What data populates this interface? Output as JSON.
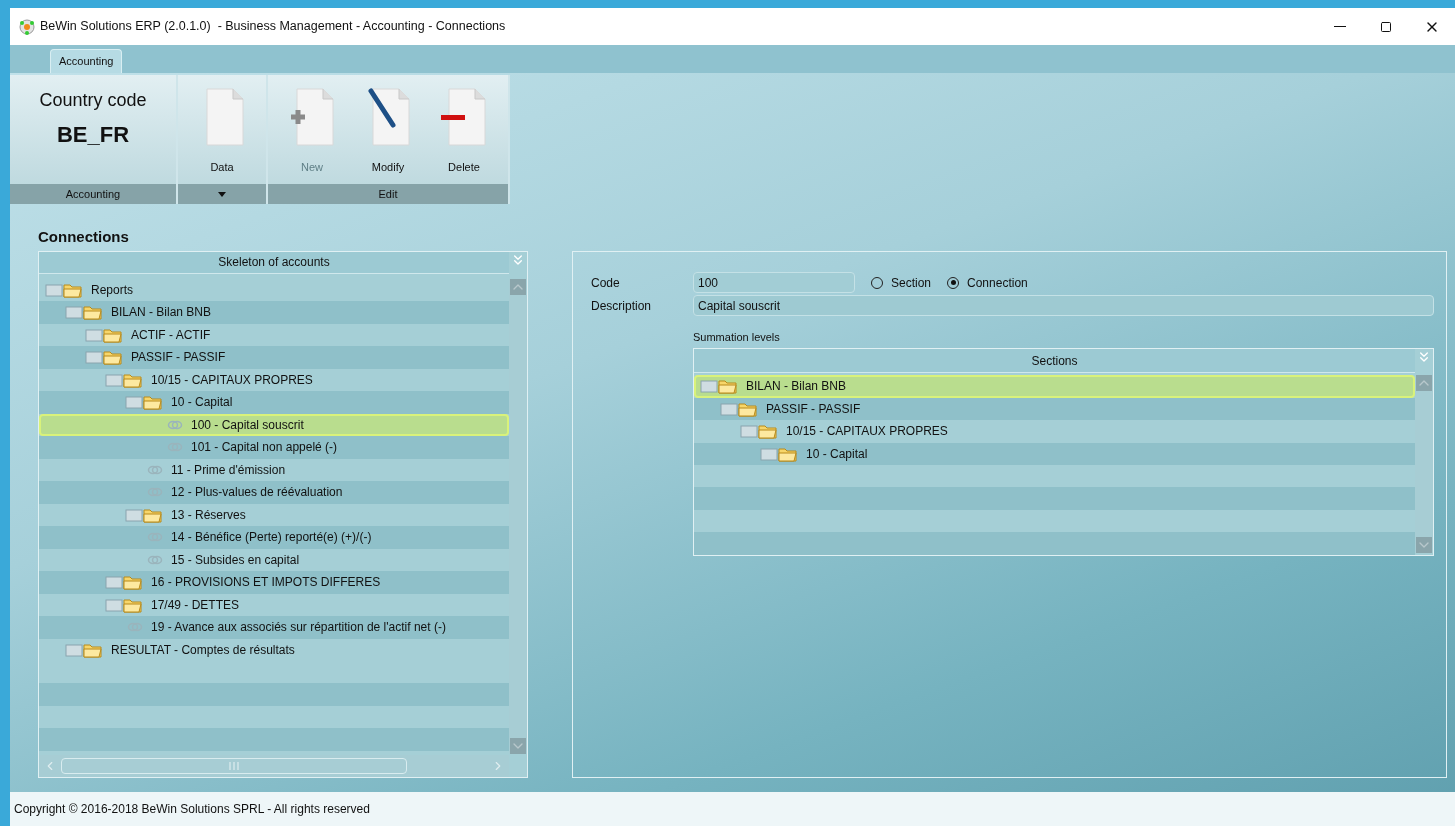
{
  "window": {
    "title": "BeWin Solutions ERP (2.0.1.0)  - Business Management - Accounting - Connections"
  },
  "ribbon": {
    "tabs": [
      {
        "label": "Accounting",
        "selected": true
      }
    ],
    "groups": [
      {
        "kind": "info",
        "caption": "Country code",
        "value": "BE_FR",
        "label": "Accounting"
      },
      {
        "kind": "buttons",
        "dropdown": true,
        "buttons": [
          {
            "label": "Data",
            "kind": "blank",
            "disabled": false
          }
        ]
      },
      {
        "kind": "buttons",
        "dropdown": false,
        "label": "Edit",
        "buttons": [
          {
            "label": "New",
            "kind": "add",
            "disabled": true
          },
          {
            "label": "Modify",
            "kind": "edit",
            "disabled": false
          },
          {
            "label": "Delete",
            "kind": "remove",
            "disabled": false
          }
        ]
      }
    ]
  },
  "page_title": "Connections",
  "tree": {
    "title": "Skeleton of accounts",
    "items": [
      {
        "label": "Reports",
        "kind": "folder",
        "selected": false,
        "children": [
          {
            "label": "BILAN - Bilan BNB",
            "kind": "folder",
            "selected": false,
            "children": [
              {
                "label": "ACTIF - ACTIF",
                "kind": "folder",
                "selected": false
              },
              {
                "label": "PASSIF - PASSIF",
                "kind": "folder",
                "selected": false,
                "children": [
                  {
                    "label": "10/15 - CAPITAUX PROPRES",
                    "kind": "folder",
                    "selected": false,
                    "children": [
                      {
                        "label": "10 - Capital",
                        "kind": "folder",
                        "selected": false,
                        "children": [
                          {
                            "label": "100 - Capital souscrit",
                            "kind": "link",
                            "selected": true
                          },
                          {
                            "label": "101 - Capital non appelé (-)",
                            "kind": "link",
                            "selected": false
                          }
                        ]
                      },
                      {
                        "label": "11 - Prime d'émission",
                        "kind": "link",
                        "selected": false
                      },
                      {
                        "label": "12 - Plus-values de réévaluation",
                        "kind": "link",
                        "selected": false
                      },
                      {
                        "label": "13 - Réserves",
                        "kind": "folder",
                        "selected": false
                      },
                      {
                        "label": "14 - Bénéfice (Perte) reporté(e) (+)/(-)",
                        "kind": "link",
                        "selected": false
                      },
                      {
                        "label": "15 - Subsides en capital",
                        "kind": "link",
                        "selected": false
                      }
                    ]
                  },
                  {
                    "label": "16 - PROVISIONS ET IMPOTS DIFFERES",
                    "kind": "folder",
                    "selected": false
                  },
                  {
                    "label": "17/49 - DETTES",
                    "kind": "folder",
                    "selected": false
                  },
                  {
                    "label": "19 - Avance aux associés sur répartition de l'actif net (-)",
                    "kind": "link",
                    "selected": false
                  }
                ]
              }
            ]
          },
          {
            "label": "RESULTAT - Comptes de résultats",
            "kind": "folder",
            "selected": false
          }
        ]
      }
    ]
  },
  "form": {
    "code_label": "Code",
    "code": "100",
    "options": [
      {
        "label": "Section",
        "selected": false
      },
      {
        "label": "Connection",
        "selected": true
      }
    ],
    "description_label": "Description",
    "description": "Capital souscrit",
    "summation_label": "Summation levels",
    "sections": {
      "title": "Sections",
      "items": [
        {
          "label": "BILAN - Bilan BNB",
          "kind": "folder",
          "selected": true,
          "children": [
            {
              "label": "PASSIF - PASSIF",
              "kind": "folder",
              "selected": false,
              "children": [
                {
                  "label": "10/15 - CAPITAUX PROPRES",
                  "kind": "folder",
                  "selected": false,
                  "children": [
                    {
                      "label": "10 - Capital",
                      "kind": "folder",
                      "selected": false
                    }
                  ]
                }
              ]
            }
          ]
        }
      ]
    }
  },
  "status_bar": "Copyright © 2016-2018 BeWin Solutions SPRL - All rights reserved"
}
